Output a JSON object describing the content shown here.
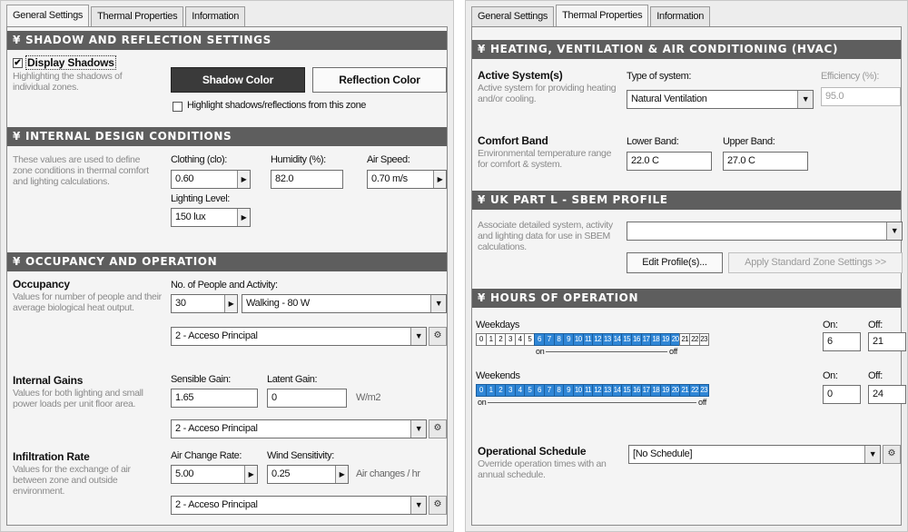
{
  "left": {
    "tabs": [
      {
        "label": "General Settings",
        "u": "G",
        "rest": "eneral Settings"
      },
      {
        "label": "Thermal Properties",
        "pre": "",
        "u": "",
        "rest": "Thermal Properties"
      },
      {
        "label": "Information",
        "u": "I",
        "rest": "nformation"
      }
    ],
    "shadow": {
      "header": "SHADOW AND REFLECTION SETTINGS",
      "display_shadows_label": "Display Shadows",
      "display_shadows_checked": "✔",
      "desc": "Highlighting the shadows of individual zones.",
      "shadow_color_btn": "Shadow Color",
      "reflection_color_btn": "Reflection Color",
      "highlight_label": "Highlight shadows/reflections from this zone"
    },
    "internal_design": {
      "header": "INTERNAL DESIGN CONDITIONS",
      "desc": "These values are used to define zone conditions in thermal comfort and lighting calculations.",
      "clothing_label": "Clothing (clo):",
      "clothing_value": "0.60",
      "humidity_label": "Humidity (%):",
      "humidity_value": "82.0",
      "air_speed_label": "Air Speed:",
      "air_speed_value": "0.70 m/s",
      "lighting_label": "Lighting Level:",
      "lighting_value": "150 lux"
    },
    "occupancy": {
      "header": "OCCUPANCY AND OPERATION",
      "occ_title": "Occupancy",
      "occ_desc": "Values for number of people and their average biological heat output.",
      "people_label": "No. of People and Activity:",
      "people_value": "30",
      "activity_value": "Walking - 80 W",
      "occ_schedule": "2 - Acceso Principal",
      "gains_title": "Internal Gains",
      "gains_desc": "Values for both lighting and small power loads per unit floor area.",
      "sensible_label": "Sensible Gain:",
      "sensible_value": "1.65",
      "latent_label": "Latent Gain:",
      "latent_value": "0",
      "gain_unit": "W/m2",
      "gains_schedule": "2 - Acceso Principal",
      "infil_title": "Infiltration Rate",
      "infil_desc": "Values for the exchange of air between zone and outside environment.",
      "acr_label": "Air Change Rate:",
      "acr_value": "5.00",
      "wind_label": "Wind Sensitivity:",
      "wind_value": "0.25",
      "infil_unit": "Air changes / hr",
      "infil_schedule": "2 - Acceso Principal"
    }
  },
  "right": {
    "tabs": [
      "General Settings",
      "Thermal Properties",
      "Information"
    ],
    "hvac": {
      "header": "HEATING, VENTILATION & AIR CONDITIONING (HVAC)",
      "active_title": "Active System(s)",
      "active_desc": "Active system for providing heating and/or cooling.",
      "type_label": "Type of system:",
      "type_value": "Natural Ventilation",
      "efficiency_label": "Efficiency (%):",
      "efficiency_value": "95.0",
      "comfort_title": "Comfort Band",
      "comfort_desc": "Environmental temperature range for comfort & system.",
      "lower_label": "Lower Band:",
      "lower_value": "22.0 C",
      "upper_label": "Upper Band:",
      "upper_value": "27.0 C"
    },
    "sbem": {
      "header": "UK PART L - SBEM PROFILE",
      "desc": "Associate detailed system, activity and lighting data for use in SBEM calculations.",
      "select_value": "",
      "edit_btn": "Edit Profile(s)...",
      "apply_btn": "Apply Standard Zone Settings >>"
    },
    "hours": {
      "header": "HOURS OF OPERATION",
      "weekdays_label": "Weekdays",
      "weekends_label": "Weekends",
      "on_label": "On:",
      "off_label": "Off:",
      "weekday_on": "6",
      "weekday_off": "21",
      "weekend_on": "0",
      "weekend_off": "24",
      "bracket_on": "on",
      "bracket_off": "off",
      "hours_labels": [
        "0",
        "1",
        "2",
        "3",
        "4",
        "5",
        "6",
        "7",
        "8",
        "9",
        "10",
        "11",
        "12",
        "13",
        "14",
        "15",
        "16",
        "17",
        "18",
        "19",
        "20",
        "21",
        "22",
        "23"
      ],
      "weekday_active_from": 6,
      "weekday_active_to": 21,
      "weekend_active_from": 0,
      "weekend_active_to": 24
    },
    "schedule": {
      "title": "Operational Schedule",
      "desc": "Override operation times with an annual schedule.",
      "value": "[No Schedule]"
    }
  }
}
